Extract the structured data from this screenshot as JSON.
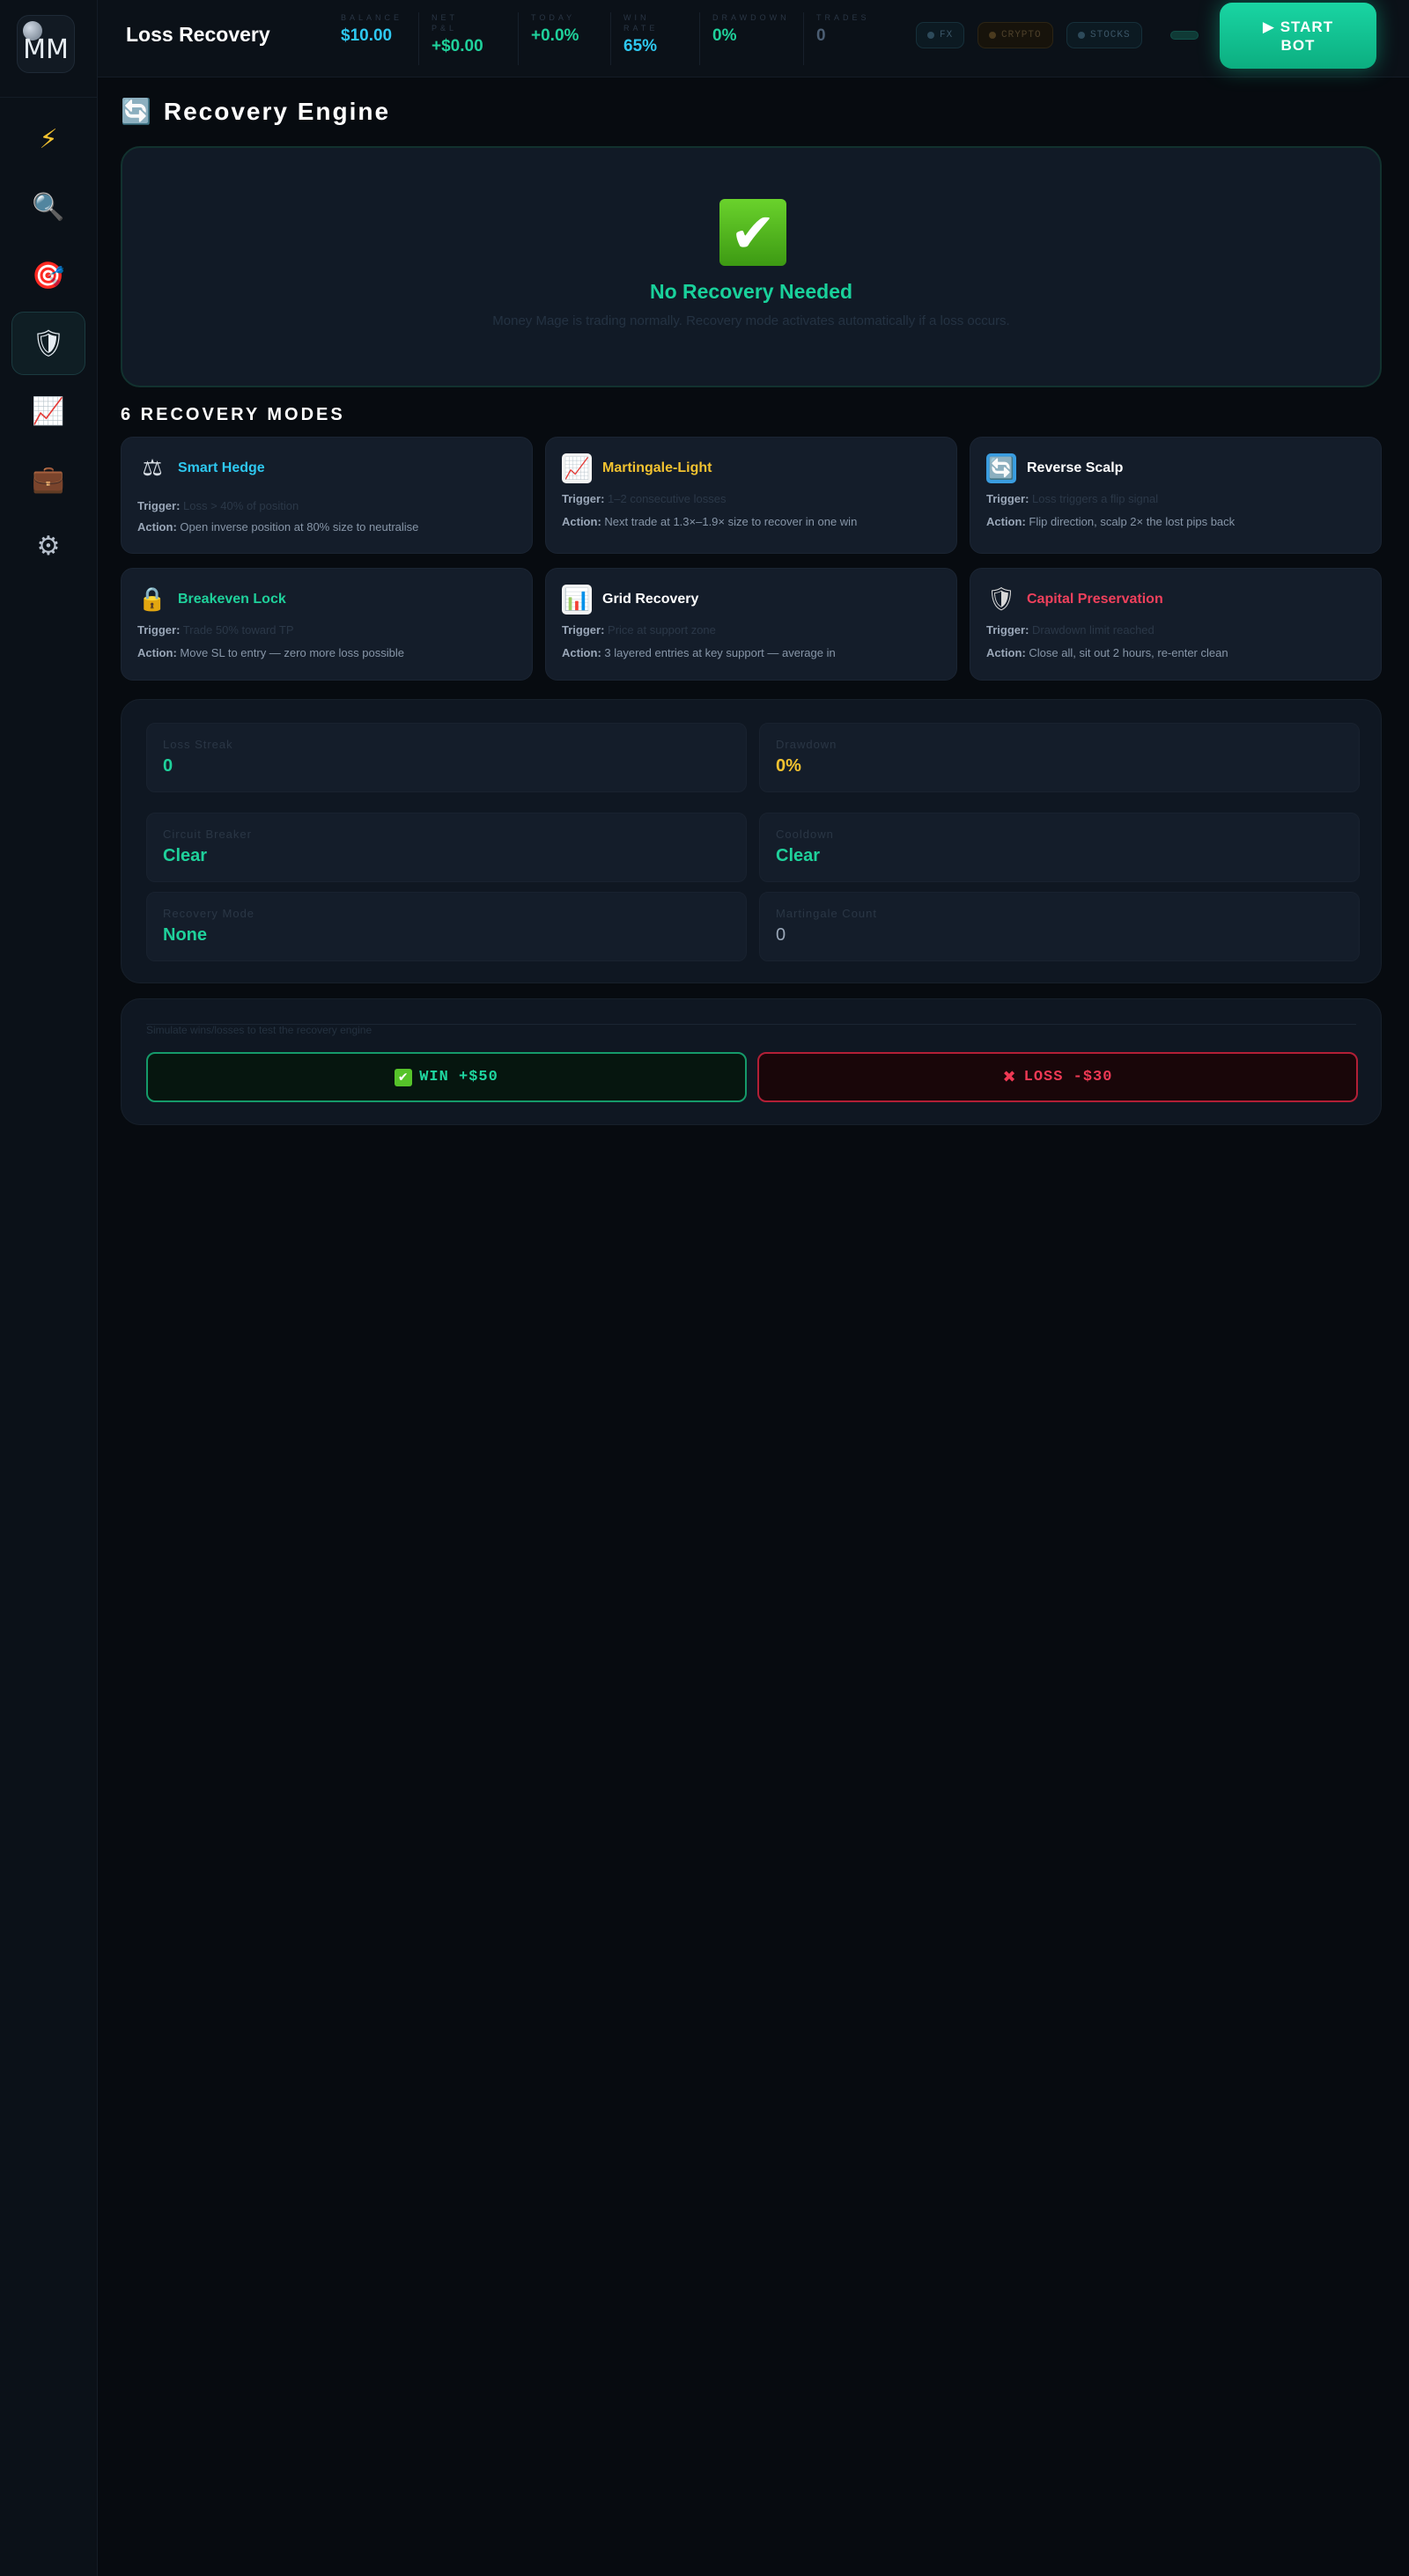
{
  "app": {
    "logo_text": "MM",
    "page_title": "Loss Recovery"
  },
  "sidebar": {
    "items": [
      {
        "name": "lightning",
        "icon": "⚡",
        "active": false
      },
      {
        "name": "search",
        "icon": "🔍",
        "active": false
      },
      {
        "name": "target",
        "icon": "🎯",
        "active": false
      },
      {
        "name": "shield",
        "icon": "🛡",
        "active": true
      },
      {
        "name": "chart",
        "icon": "📈",
        "active": false
      },
      {
        "name": "briefcase",
        "icon": "💼",
        "active": false
      },
      {
        "name": "settings",
        "icon": "⚙",
        "active": false
      }
    ]
  },
  "stats": [
    {
      "label": "BALANCE",
      "value": "$10.00",
      "color": "#2ec8f0"
    },
    {
      "label": "NET P&L",
      "value": "+$0.00",
      "color": "#1fd19b"
    },
    {
      "label": "TODAY",
      "value": "+0.0%",
      "color": "#1fd19b"
    },
    {
      "label": "WIN RATE",
      "value": "65%",
      "color": "#2ec8f0"
    },
    {
      "label": "DRAWDOWN",
      "value": "0%",
      "color": "#1fd19b"
    },
    {
      "label": "TRADES",
      "value": "0",
      "color": "#4b5d72"
    }
  ],
  "markets": [
    {
      "label": "FX",
      "color": "#2d4a5a",
      "text": "#3b5566",
      "bg": "#0c1a22",
      "border": "#16303a"
    },
    {
      "label": "CRYPTO",
      "color": "#4a3a1e",
      "text": "#4d402a",
      "bg": "#17130b",
      "border": "#2c2414"
    },
    {
      "label": "STOCKS",
      "color": "#2d4a5a",
      "text": "#3b5566",
      "bg": "#0c1a22",
      "border": "#16303a"
    }
  ],
  "toolbar": {
    "start_label": "▶ START BOT"
  },
  "engine": {
    "title": "Recovery Engine",
    "status_title": "No Recovery Needed",
    "status_desc": "Money Mage is trading normally. Recovery mode activates automatically if a loss occurs."
  },
  "modes_title": "6 RECOVERY MODES",
  "modes": [
    {
      "name": "Smart Hedge",
      "icon": "⚖",
      "color": "#2ec8f0",
      "trigger_label": "Trigger:",
      "trigger": "Loss > 40% of position",
      "action_label": "Action:",
      "action": "Open inverse position at 80% size to neutralise"
    },
    {
      "name": "Martingale-Light",
      "icon": "📈",
      "color": "#f2c230",
      "trigger_label": "Trigger:",
      "trigger": "1–2 consecutive losses",
      "action_label": "Action:",
      "action": "Next trade at 1.3×–1.9× size to recover in one win"
    },
    {
      "name": "Reverse Scalp",
      "icon": "🔄",
      "color": "#ffffff",
      "trigger_label": "Trigger:",
      "trigger": "Loss triggers a flip signal",
      "action_label": "Action:",
      "action": "Flip direction, scalp 2× the lost pips back"
    },
    {
      "name": "Breakeven Lock",
      "icon": "🔒",
      "color": "#1fd19b",
      "trigger_label": "Trigger:",
      "trigger": "Trade 50% toward TP",
      "action_label": "Action:",
      "action": "Move SL to entry — zero more loss possible"
    },
    {
      "name": "Grid Recovery",
      "icon": "📊",
      "color": "#ffffff",
      "trigger_label": "Trigger:",
      "trigger": "Price at support zone",
      "action_label": "Action:",
      "action": "3 layered entries at key support — average in"
    },
    {
      "name": "Capital Preservation",
      "icon": "🛡",
      "color": "#f0405c",
      "trigger_label": "Trigger:",
      "trigger": "Drawdown limit reached",
      "action_label": "Action:",
      "action": "Close all, sit out 2 hours, re-enter clean"
    }
  ],
  "metrics": [
    {
      "label": "Loss Streak",
      "value": "0",
      "color": "#1fd19b"
    },
    {
      "label": "Drawdown",
      "value": "0%",
      "color": "#f2c230"
    },
    {
      "label": "Circuit Breaker",
      "value": "Clear",
      "color": "#1fd19b"
    },
    {
      "label": "Cooldown",
      "value": "Clear",
      "color": "#1fd19b"
    },
    {
      "label": "Recovery Mode",
      "value": "None",
      "color": "#1fd19b"
    },
    {
      "label": "Martingale Count",
      "value": "0",
      "color": "#9aa7b8"
    }
  ],
  "simulate": {
    "label": "Simulate wins/losses to test the recovery engine",
    "win_icon": "✔",
    "win_label": "WIN +$50",
    "loss_icon": "✖",
    "loss_label": "LOSS -$30"
  }
}
